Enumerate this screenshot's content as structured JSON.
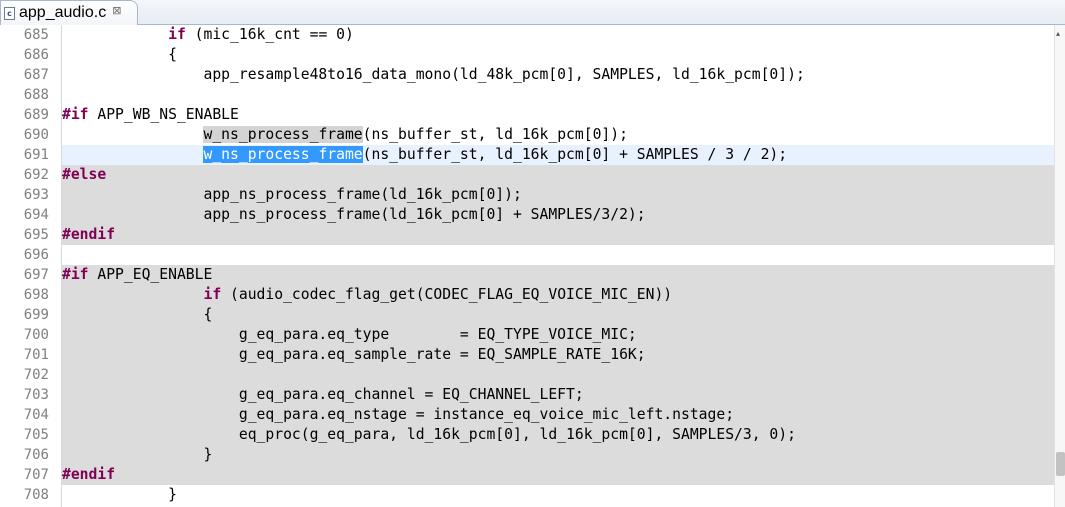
{
  "tab": {
    "title": "app_audio.c",
    "close_glyph": "⊠",
    "file_icon": "c-source-file-icon",
    "file_icon_glyph": "c"
  },
  "editor": {
    "lines": [
      {
        "n": "685",
        "bg": "",
        "segs": [
          {
            "t": "            ",
            "c": ""
          },
          {
            "t": "if",
            "c": "kw"
          },
          {
            "t": " (mic_16k_cnt == 0)",
            "c": ""
          }
        ]
      },
      {
        "n": "686",
        "bg": "",
        "segs": [
          {
            "t": "            {",
            "c": ""
          }
        ]
      },
      {
        "n": "687",
        "bg": "",
        "segs": [
          {
            "t": "                app_resample48to16_data_mono(ld_48k_pcm[0], SAMPLES, ld_16k_pcm[0]);",
            "c": ""
          }
        ]
      },
      {
        "n": "688",
        "bg": "",
        "segs": []
      },
      {
        "n": "689",
        "bg": "",
        "segs": [
          {
            "t": "#if",
            "c": "kw"
          },
          {
            "t": " APP_WB_NS_ENABLE",
            "c": ""
          }
        ]
      },
      {
        "n": "690",
        "bg": "",
        "segs": [
          {
            "t": "                ",
            "c": ""
          },
          {
            "t": "w_ns_process_frame",
            "c": "occ"
          },
          {
            "t": "(ns_buffer_st, ld_16k_pcm[0]);",
            "c": ""
          }
        ]
      },
      {
        "n": "691",
        "bg": "cur",
        "segs": [
          {
            "t": "                ",
            "c": ""
          },
          {
            "t": "w_ns_process_frame",
            "c": "sel"
          },
          {
            "t": "(ns_buffer_st, ld_16k_pcm[0] + SAMPLES / 3 / 2);",
            "c": ""
          }
        ]
      },
      {
        "n": "692",
        "bg": "gray",
        "segs": [
          {
            "t": "#else",
            "c": "kw"
          }
        ]
      },
      {
        "n": "693",
        "bg": "gray",
        "segs": [
          {
            "t": "                app_ns_process_frame(ld_16k_pcm[0]);",
            "c": ""
          }
        ]
      },
      {
        "n": "694",
        "bg": "gray",
        "segs": [
          {
            "t": "                app_ns_process_frame(ld_16k_pcm[0] + SAMPLES/3/2);",
            "c": ""
          }
        ]
      },
      {
        "n": "695",
        "bg": "gray",
        "segs": [
          {
            "t": "#endif",
            "c": "kw"
          }
        ]
      },
      {
        "n": "696",
        "bg": "",
        "segs": []
      },
      {
        "n": "697",
        "bg": "gray",
        "segs": [
          {
            "t": "#if",
            "c": "kw"
          },
          {
            "t": " APP_EQ_ENABLE",
            "c": ""
          }
        ]
      },
      {
        "n": "698",
        "bg": "gray",
        "segs": [
          {
            "t": "                ",
            "c": ""
          },
          {
            "t": "if",
            "c": "kw"
          },
          {
            "t": " (audio_codec_flag_get(CODEC_FLAG_EQ_VOICE_MIC_EN))",
            "c": ""
          }
        ]
      },
      {
        "n": "699",
        "bg": "gray",
        "segs": [
          {
            "t": "                {",
            "c": ""
          }
        ]
      },
      {
        "n": "700",
        "bg": "gray",
        "segs": [
          {
            "t": "                    g_eq_para.eq_type        = EQ_TYPE_VOICE_MIC;",
            "c": ""
          }
        ]
      },
      {
        "n": "701",
        "bg": "gray",
        "segs": [
          {
            "t": "                    g_eq_para.eq_sample_rate = EQ_SAMPLE_RATE_16K;",
            "c": ""
          }
        ]
      },
      {
        "n": "702",
        "bg": "gray",
        "segs": []
      },
      {
        "n": "703",
        "bg": "gray",
        "segs": [
          {
            "t": "                    g_eq_para.eq_channel = EQ_CHANNEL_LEFT;",
            "c": ""
          }
        ]
      },
      {
        "n": "704",
        "bg": "gray",
        "segs": [
          {
            "t": "                    g_eq_para.eq_nstage = instance_eq_voice_mic_left.nstage;",
            "c": ""
          }
        ]
      },
      {
        "n": "705",
        "bg": "gray",
        "segs": [
          {
            "t": "                    eq_proc(g_eq_para, ld_16k_pcm[0], ld_16k_pcm[0], SAMPLES/3, 0);",
            "c": ""
          }
        ]
      },
      {
        "n": "706",
        "bg": "gray",
        "segs": [
          {
            "t": "                }",
            "c": ""
          }
        ]
      },
      {
        "n": "707",
        "bg": "gray",
        "segs": [
          {
            "t": "#endif",
            "c": "kw"
          }
        ]
      },
      {
        "n": "708",
        "bg": "",
        "segs": [
          {
            "t": "            }",
            "c": ""
          }
        ]
      }
    ]
  },
  "scrollbar": {
    "up_arrow": "▴",
    "arrow_icon": "scroll-up-arrow-icon"
  },
  "colors": {
    "keyword": "#7f0055",
    "inactive_code_bg": "#dcdcdc",
    "current_line_bg": "#e8f2fe",
    "selection_bg": "#3399ff",
    "occurrence_bg": "#d4d4d4",
    "line_number": "#7f7f7f"
  }
}
